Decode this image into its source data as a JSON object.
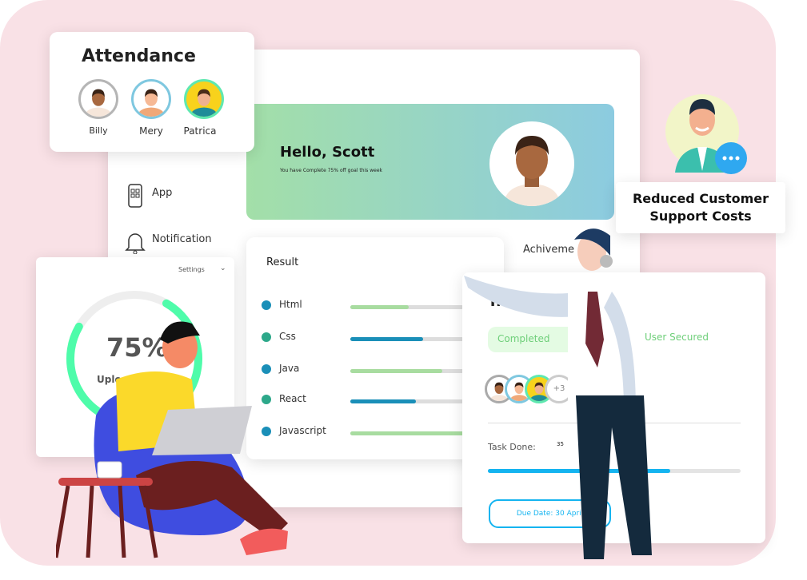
{
  "attendance": {
    "title": "Attendance",
    "people": [
      {
        "name": "Billy"
      },
      {
        "name": "Mery"
      },
      {
        "name": "Patrica"
      }
    ]
  },
  "sidebar": {
    "items": [
      {
        "label": "App",
        "icon": "phone-app-icon"
      },
      {
        "label": "Notification",
        "icon": "bell-icon"
      }
    ]
  },
  "banner": {
    "greeting": "Hello, Scott",
    "subtitle": "You have Complete 75% off goal this week",
    "colors": [
      "#a3dfa8",
      "#8ccbe0"
    ]
  },
  "result": {
    "title": "Result",
    "items": [
      {
        "label": "Html",
        "progress": 40,
        "color": "#a8dca0",
        "dot": "#1a8fb8"
      },
      {
        "label": "Css",
        "progress": 50,
        "color": "#1a8fb8",
        "dot": "#2da88a"
      },
      {
        "label": "Java",
        "progress": 63,
        "color": "#a8dca0",
        "dot": "#1a8fb8"
      },
      {
        "label": "React",
        "progress": 45,
        "color": "#1a8fb8",
        "dot": "#2da88a"
      },
      {
        "label": "Javascript",
        "progress": 80,
        "color": "#a8dca0",
        "dot": "#1a8fb8"
      }
    ]
  },
  "achievement": {
    "title": "Achiveme"
  },
  "upload": {
    "settings": "Settings",
    "percent_label": "75%",
    "progress": 75,
    "caption": "Uplo",
    "color": "#4efcaa"
  },
  "training": {
    "title": "Traini",
    "completed": "Completed",
    "user_secured": "User Secured",
    "more_count": "+3",
    "task_label": "Task Done:",
    "task_value": "35",
    "task_progress": 72,
    "due_date": "Due Date: 30 April",
    "accent": "#14b4f0"
  },
  "support": {
    "label_line1": "Reduced Customer",
    "label_line2": "Support Costs"
  }
}
